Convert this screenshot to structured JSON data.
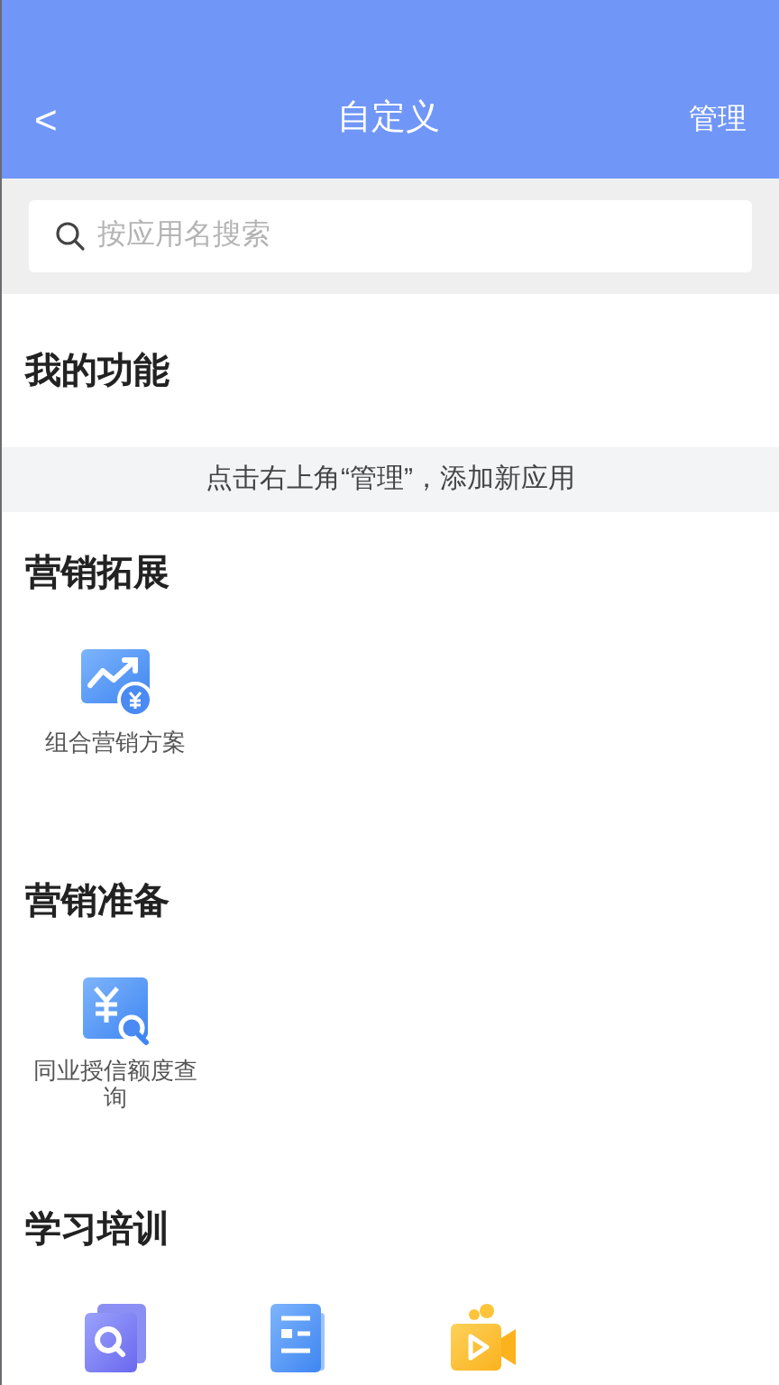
{
  "header": {
    "back": "<",
    "title": "自定义",
    "action": "管理"
  },
  "search": {
    "placeholder": "按应用名搜索"
  },
  "my_functions": {
    "title": "我的功能",
    "hint": "点击右上角“管理”，添加新应用"
  },
  "sections": [
    {
      "title": "营销拓展",
      "items": [
        {
          "kind": "chart-coin",
          "label": "组合营销方案"
        }
      ]
    },
    {
      "title": "营销准备",
      "items": [
        {
          "kind": "yuan-search",
          "label": "同业授信额度查询"
        }
      ]
    },
    {
      "title": "学习培训",
      "items": [
        {
          "kind": "doc-search"
        },
        {
          "kind": "article"
        },
        {
          "kind": "video"
        }
      ]
    }
  ]
}
